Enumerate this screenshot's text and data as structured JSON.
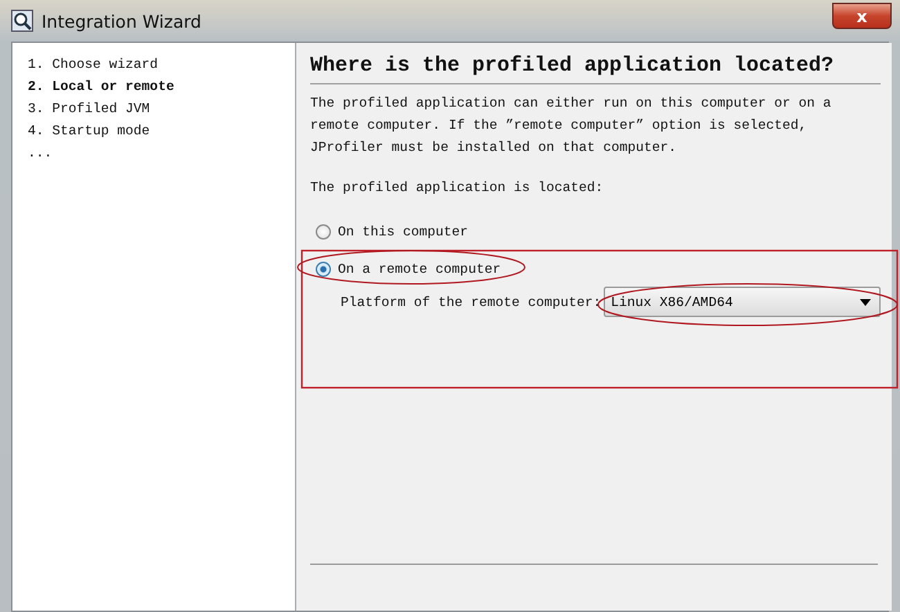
{
  "window": {
    "title": "Integration Wizard",
    "close": "x"
  },
  "steps": [
    {
      "label": "1. Choose wizard",
      "selected": false
    },
    {
      "label": "2. Local or remote",
      "selected": true
    },
    {
      "label": "3. Profiled JVM",
      "selected": false
    },
    {
      "label": "4. Startup mode",
      "selected": false
    },
    {
      "label": "...",
      "selected": false
    }
  ],
  "heading": "Where is the profiled application located?",
  "description": "The profiled application can either run on this computer or on a remote computer. If the ”remote computer” option is selected, JProfiler must be installed on that computer.",
  "location_label": "The profiled application is located:",
  "options": [
    {
      "label": "On this computer",
      "selected": false
    },
    {
      "label": "On a remote computer",
      "selected": true
    }
  ],
  "platform": {
    "label": "Platform of the remote computer:",
    "value": "Linux X86/AMD64"
  }
}
